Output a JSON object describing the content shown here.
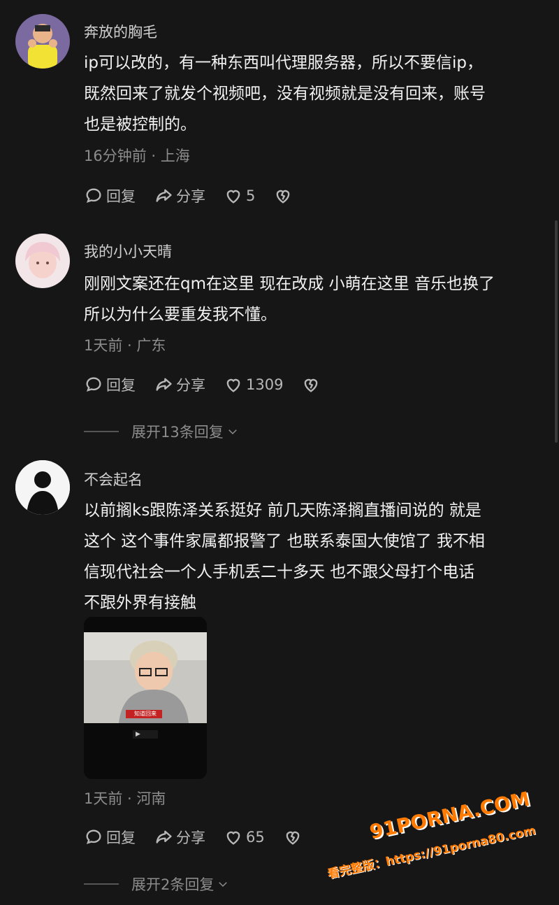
{
  "comments": [
    {
      "username": "奔放的胸毛",
      "text_lines": [
        "ip可以改的，有一种东西叫代理服务器，所以不要信ip，",
        "既然回来了就发个视频吧，没有视频就是没有回来，账号",
        "也是被控制的。"
      ],
      "meta": "16分钟前 · 上海",
      "reply_label": "回复",
      "share_label": "分享",
      "likes": "5"
    },
    {
      "username": "我的小小天晴",
      "text_lines": [
        "刚刚文案还在qm在这里 现在改成 小萌在这里 音乐也换了",
        "所以为什么要重发我不懂。"
      ],
      "meta": "1天前 · 广东",
      "reply_label": "回复",
      "share_label": "分享",
      "likes": "1309",
      "expand_label": "展开13条回复"
    },
    {
      "username": "不会起名",
      "text_lines": [
        "以前搁ks跟陈泽关系挺好 前几天陈泽搁直播间说的 就是",
        "这个 这个事件家属都报警了 也联系泰国大使馆了 我不相",
        "信现代社会一个人手机丢二十多天 也不跟父母打个电话",
        "不跟外界有接触"
      ],
      "video_caption": "知道回来",
      "meta": "1天前 · 河南",
      "reply_label": "回复",
      "share_label": "分享",
      "likes": "65",
      "expand_label": "展开2条回复"
    }
  ],
  "watermark": {
    "brand": "91PORNA.COM",
    "line2": "看完整版：https://91porna80.com"
  },
  "colors": {
    "background": "#161616",
    "text": "#f1f1f1",
    "muted": "#8c8c8c",
    "watermark": "#ff7a00"
  }
}
